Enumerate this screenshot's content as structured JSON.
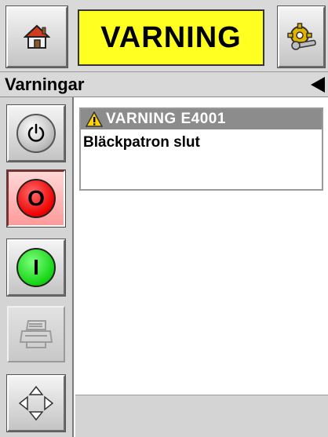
{
  "header": {
    "home_icon": "home-icon",
    "banner_text": "VARNING",
    "settings_icon": "gear-wrench-icon",
    "banner_color": "#ffff22"
  },
  "title_bar": {
    "title": "Varningar",
    "back_icon": "triangle-left-icon"
  },
  "side_buttons": {
    "power_icon": "power-icon",
    "stop_label": "O",
    "start_label": "I",
    "print_icon": "printer-icon",
    "nav_icon": "four-arrows-icon"
  },
  "alerts": [
    {
      "code": "VARNING E4001",
      "message": "Bläckpatron slut",
      "icon": "warning-triangle-icon"
    }
  ],
  "colors": {
    "stop": "#ee0000",
    "start": "#14d414",
    "warning": "#ffd400"
  }
}
